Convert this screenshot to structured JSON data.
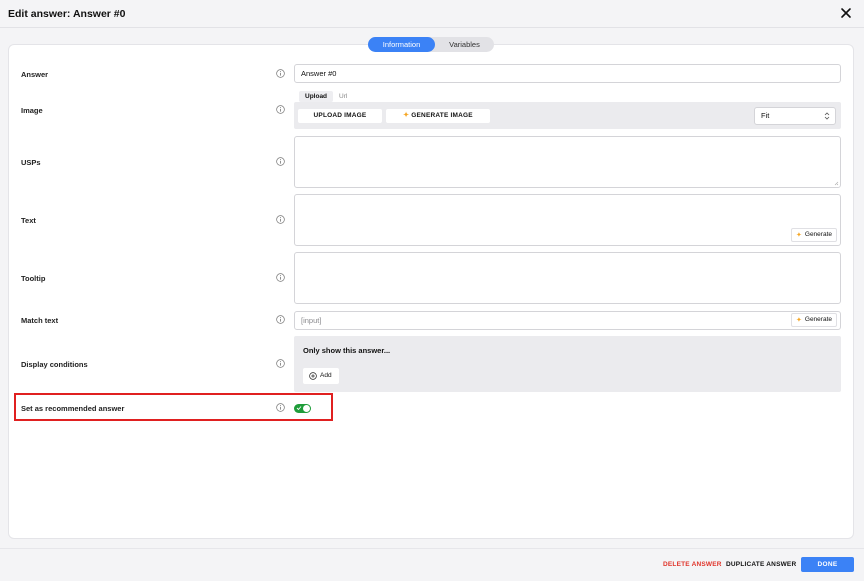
{
  "dialog": {
    "title": "Edit answer: Answer #0"
  },
  "tabs": [
    {
      "label": "Information",
      "active": true
    },
    {
      "label": "Variables",
      "active": false
    }
  ],
  "fields": {
    "answer": {
      "label": "Answer",
      "value": "Answer #0"
    },
    "image": {
      "label": "Image",
      "source_tabs": [
        "Upload",
        "Url"
      ],
      "upload_button": "UPLOAD IMAGE",
      "generate_button": "GENERATE IMAGE",
      "fit_select": "Fit"
    },
    "usps": {
      "label": "USPs",
      "value": ""
    },
    "text": {
      "label": "Text",
      "value": "",
      "generate_button": "Generate"
    },
    "tooltip": {
      "label": "Tooltip",
      "value": ""
    },
    "match_text": {
      "label": "Match text",
      "placeholder": "[input]",
      "generate_button": "Generate"
    },
    "display_conditions": {
      "label": "Display conditions",
      "title": "Only show this answer...",
      "add_button": "Add"
    },
    "recommended": {
      "label": "Set as recommended answer",
      "enabled": true
    }
  },
  "footer": {
    "delete": "DELETE ANSWER",
    "duplicate": "DUPLICATE ANSWER",
    "done": "DONE"
  },
  "colors": {
    "accent": "#3b82f6",
    "toggle_on": "#1f9d3a",
    "danger": "#e0342a",
    "highlight": "#e02020",
    "spark": "#f5a623"
  },
  "icons": {
    "close": "close-icon",
    "info": "info-icon",
    "sparkle": "sparkle-icon",
    "add": "plus-circle-icon",
    "select": "select-arrows-icon"
  }
}
